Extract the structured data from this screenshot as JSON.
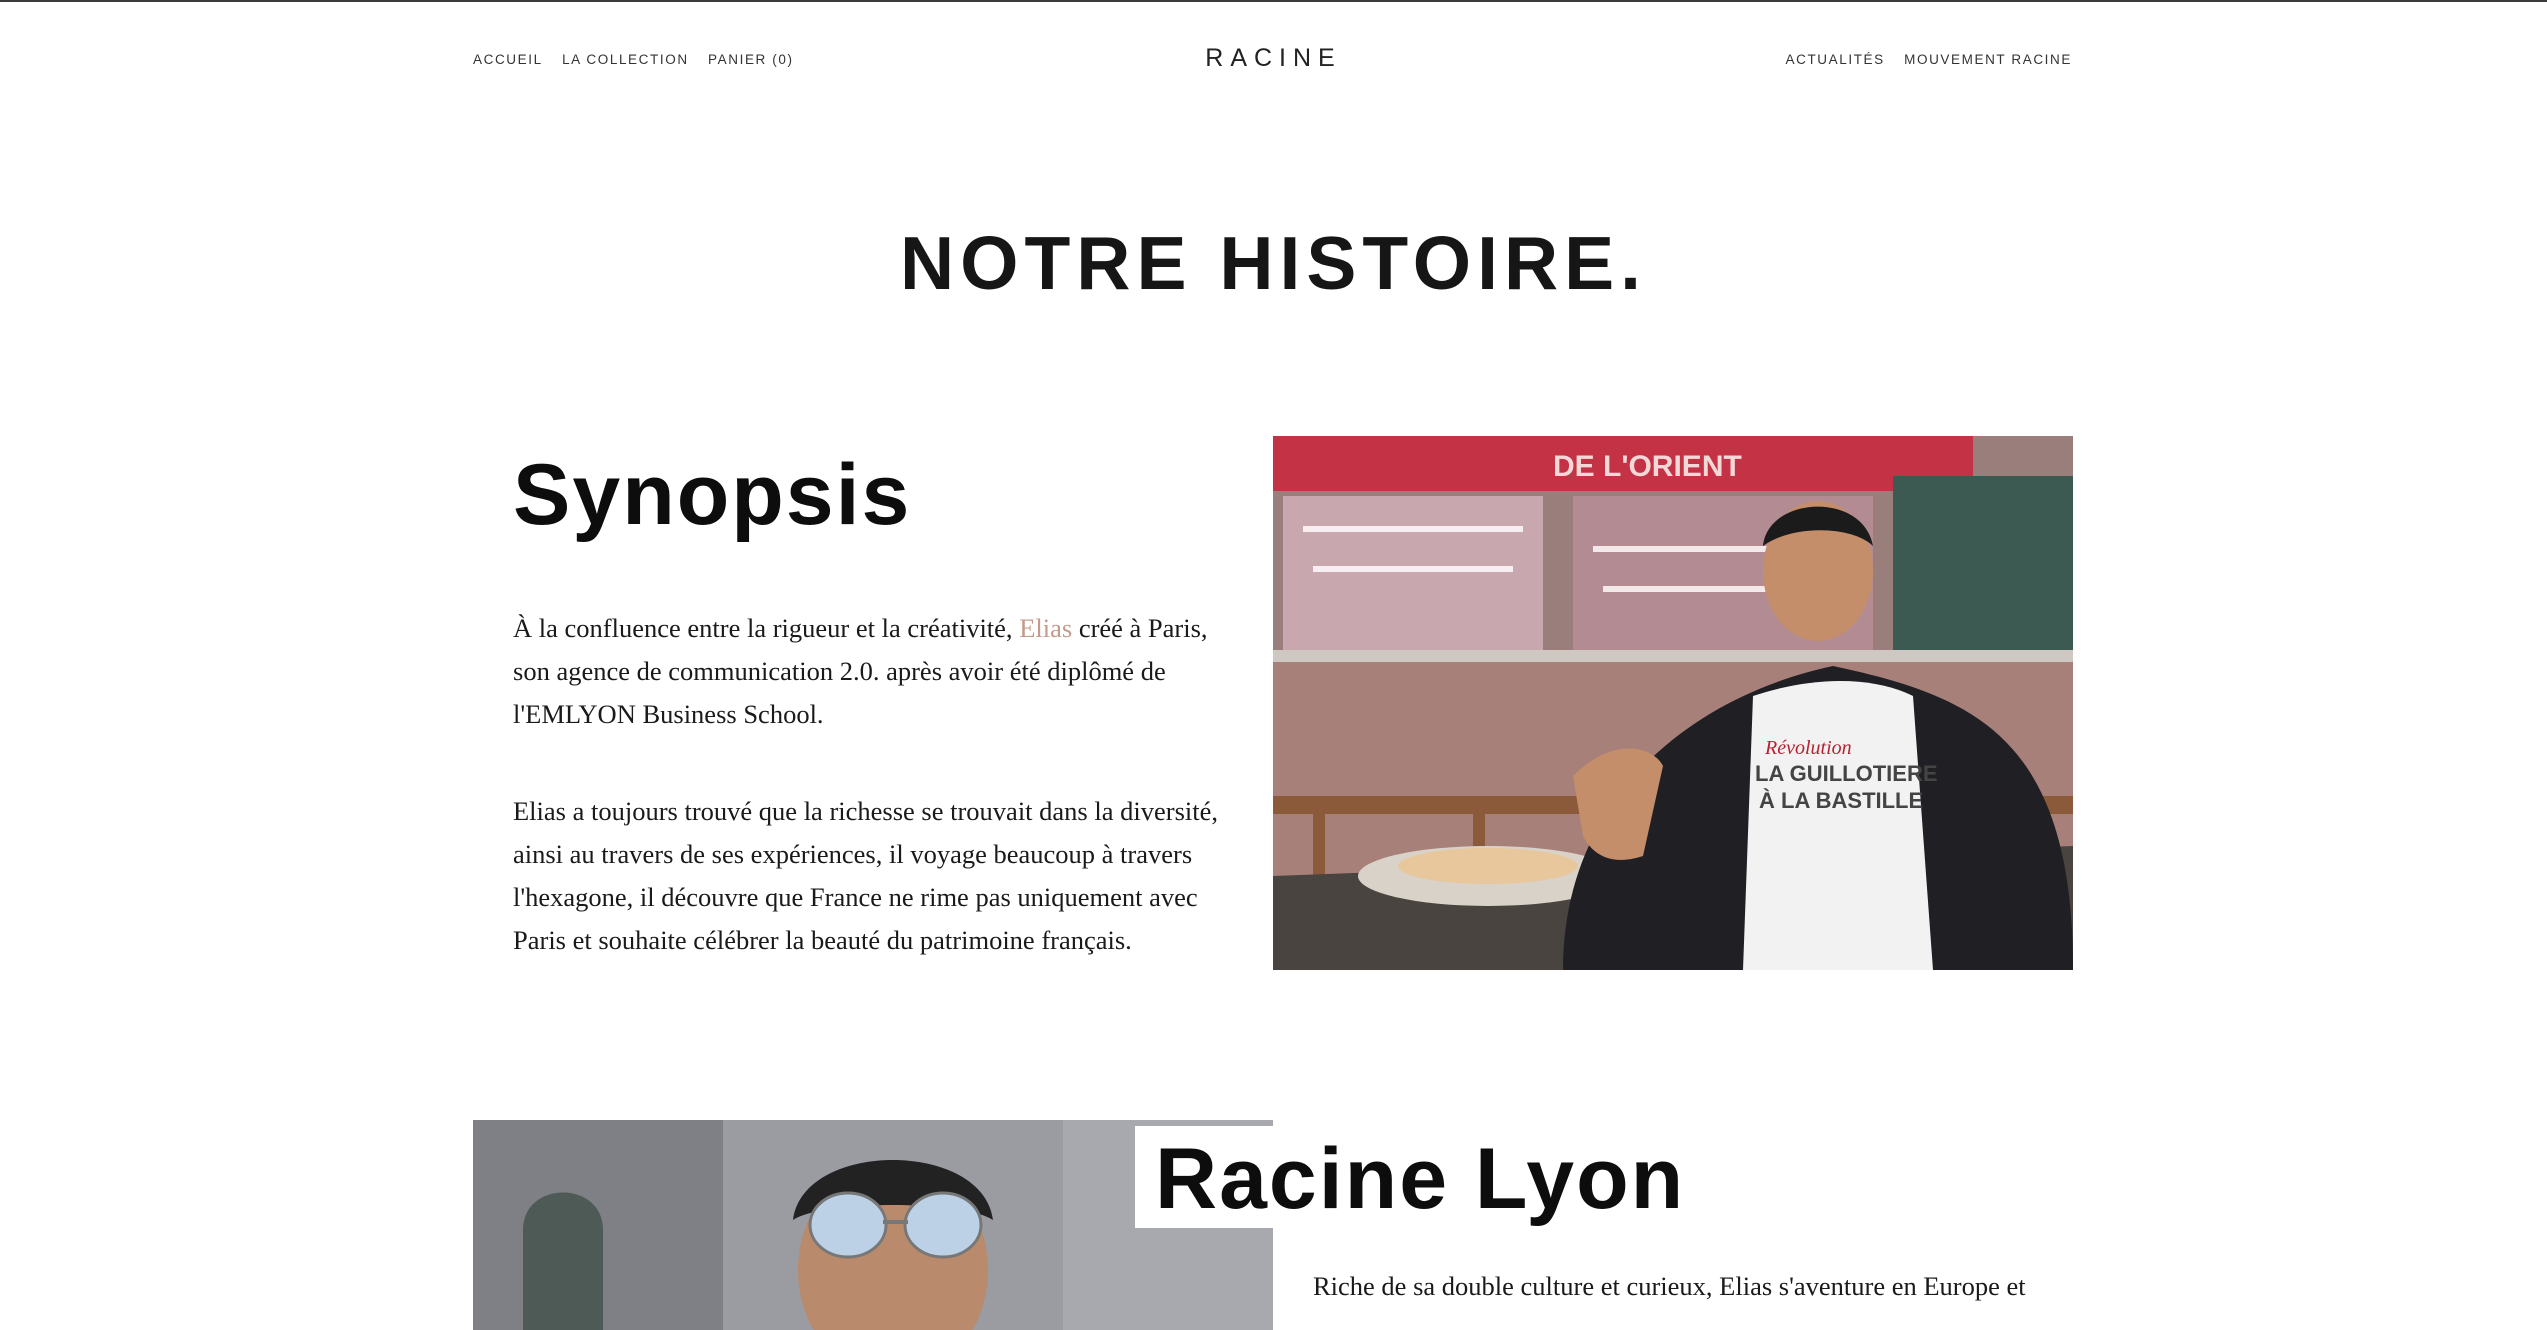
{
  "nav": {
    "left": [
      "ACCUEIL",
      "LA COLLECTION",
      "PANIER (0)"
    ],
    "right": [
      "ACTUALITÉS",
      "MOUVEMENT RACINE"
    ]
  },
  "brand": "RACINE",
  "page_title": "NOTRE HISTOIRE.",
  "synopsis": {
    "title": "Synopsis",
    "p1_before": "À la confluence entre la rigueur et la créativité, ",
    "p1_link": "Elias",
    "p1_after": " créé à Paris, son agence de communication 2.0. après avoir été diplômé de l'EMLYON Business School.",
    "p2": "Elias a toujours trouvé que la richesse se trouvait dans la diversité, ainsi au travers de ses expériences, il voyage beaucoup à travers l'hexagone, il découvre que France ne rime pas uniquement avec Paris et souhaite célébrer la beauté du patrimoine français."
  },
  "photo1": {
    "shirt_line1": "Révolution",
    "shirt_line2": "LA GUILLOTIERE",
    "shirt_line3": "À LA BASTILLE",
    "storefront_sign": "DE L'ORIENT"
  },
  "lyon": {
    "title": "Racine Lyon",
    "p1": "Riche de sa double culture et curieux, Elias s'aventure en Europe et"
  },
  "colors": {
    "accent_link": "#c49a8a",
    "text": "#111111",
    "background": "#ffffff"
  }
}
